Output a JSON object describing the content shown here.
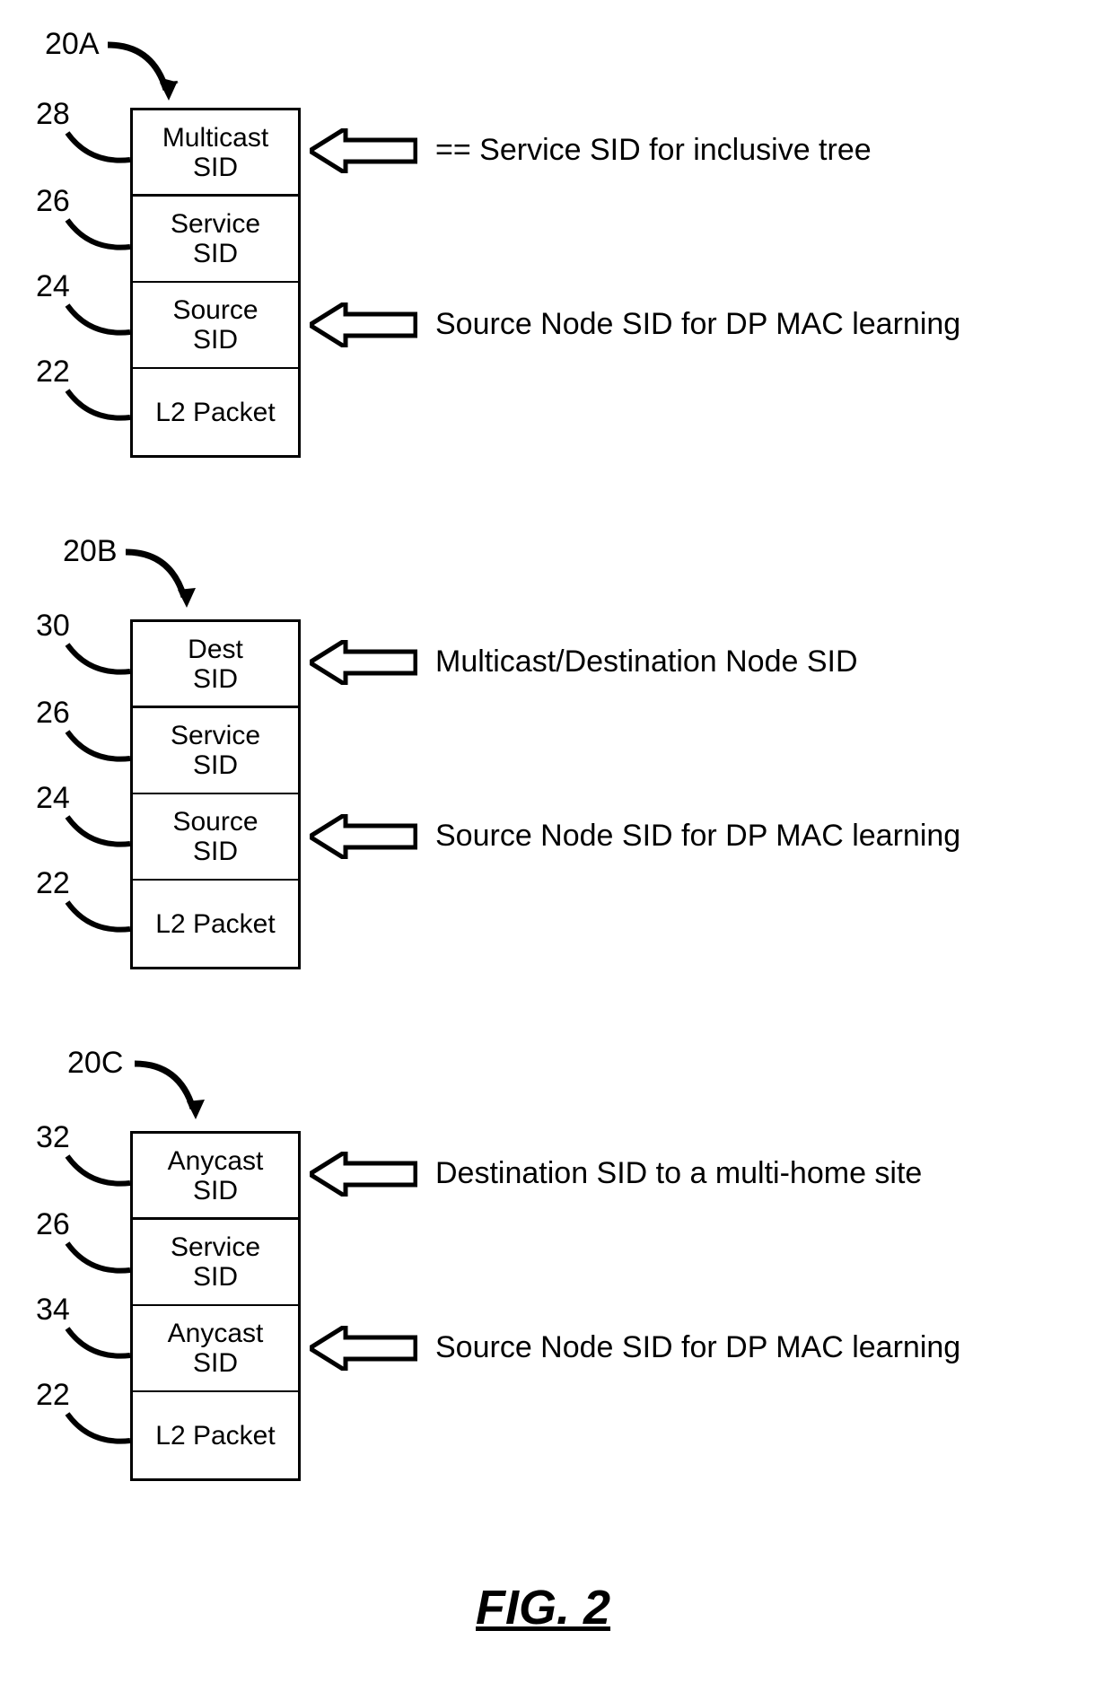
{
  "figure_caption": "FIG. 2",
  "stacks": {
    "a": {
      "label": "20A",
      "cells": {
        "c0": "Multicast\nSID",
        "c1": "Service\nSID",
        "c2": "Source\nSID",
        "c3": "L2 Packet"
      },
      "refs": {
        "r0": "28",
        "r1": "26",
        "r2": "24",
        "r3": "22"
      },
      "annot": {
        "a0": "== Service SID for inclusive tree",
        "a1": "Source Node SID for DP MAC learning"
      }
    },
    "b": {
      "label": "20B",
      "cells": {
        "c0": "Dest\nSID",
        "c1": "Service\nSID",
        "c2": "Source\nSID",
        "c3": "L2 Packet"
      },
      "refs": {
        "r0": "30",
        "r1": "26",
        "r2": "24",
        "r3": "22"
      },
      "annot": {
        "a0": "Multicast/Destination Node SID",
        "a1": "Source Node SID for DP MAC learning"
      }
    },
    "c": {
      "label": "20C",
      "cells": {
        "c0": "Anycast\nSID",
        "c1": "Service\nSID",
        "c2": "Anycast\nSID",
        "c3": "L2 Packet"
      },
      "refs": {
        "r0": "32",
        "r1": "26",
        "r2": "34",
        "r3": "22"
      },
      "annot": {
        "a0": "Destination SID to a multi-home site",
        "a1": "Source Node SID for DP MAC learning"
      }
    }
  }
}
